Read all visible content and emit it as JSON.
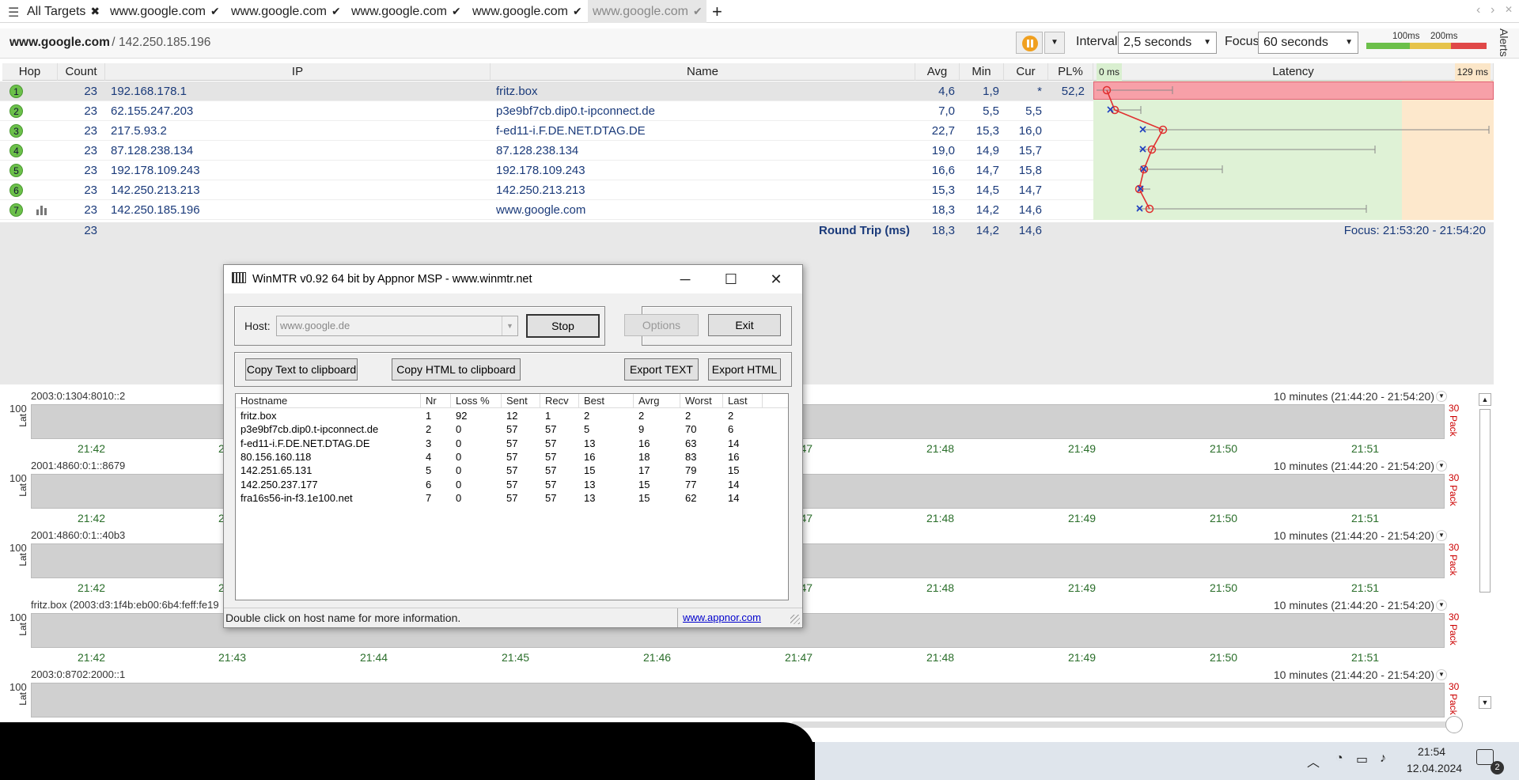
{
  "tabs": [
    {
      "label": "All Targets",
      "mark": "✖"
    },
    {
      "label": "www.google.com",
      "mark": "✔"
    },
    {
      "label": "www.google.com",
      "mark": "✔"
    },
    {
      "label": "www.google.com",
      "mark": "✔"
    },
    {
      "label": "www.google.com",
      "mark": "✔"
    },
    {
      "label": "www.google.com",
      "mark": "✔"
    }
  ],
  "nav": {
    "back": "‹",
    "fwd": "›",
    "close": "✕",
    "add": "+"
  },
  "toolbar": {
    "host": "www.google.com",
    "sep": " / ",
    "ip": "142.250.185.196",
    "interval_label": "Interval",
    "interval_value": "2,5 seconds",
    "focus_label": "Focus",
    "focus_value": "60 seconds",
    "legend_100": "100ms",
    "legend_200": "200ms",
    "alerts": "Alerts",
    "colors": {
      "good": "#6cc04a",
      "warn": "#e6c34a",
      "bad": "#e04848",
      "pause": "#f0a020"
    }
  },
  "grid": {
    "headers": {
      "hop": "Hop",
      "count": "Count",
      "ip": "IP",
      "name": "Name",
      "avg": "Avg",
      "min": "Min",
      "cur": "Cur",
      "pl": "PL%",
      "lat_min": "0 ms",
      "lat": "Latency",
      "lat_max": "129 ms"
    },
    "rows": [
      {
        "hop": "1",
        "count": "23",
        "ip": "192.168.178.1",
        "name": "fritz.box",
        "avg": "4,6",
        "min": "1,9",
        "cur": "*",
        "pl": "52,2"
      },
      {
        "hop": "2",
        "count": "23",
        "ip": "62.155.247.203",
        "name": "p3e9bf7cb.dip0.t-ipconnect.de",
        "avg": "7,0",
        "min": "5,5",
        "cur": "5,5",
        "pl": ""
      },
      {
        "hop": "3",
        "count": "23",
        "ip": "217.5.93.2",
        "name": "f-ed11-i.F.DE.NET.DTAG.DE",
        "avg": "22,7",
        "min": "15,3",
        "cur": "16,0",
        "pl": ""
      },
      {
        "hop": "4",
        "count": "23",
        "ip": "87.128.238.134",
        "name": "87.128.238.134",
        "avg": "19,0",
        "min": "14,9",
        "cur": "15,7",
        "pl": ""
      },
      {
        "hop": "5",
        "count": "23",
        "ip": "192.178.109.243",
        "name": "192.178.109.243",
        "avg": "16,6",
        "min": "14,7",
        "cur": "15,8",
        "pl": ""
      },
      {
        "hop": "6",
        "count": "23",
        "ip": "142.250.213.213",
        "name": "142.250.213.213",
        "avg": "15,3",
        "min": "14,5",
        "cur": "14,7",
        "pl": ""
      },
      {
        "hop": "7",
        "count": "23",
        "ip": "142.250.185.196",
        "name": "www.google.com",
        "avg": "18,3",
        "min": "14,2",
        "cur": "14,6",
        "pl": ""
      }
    ],
    "summary": {
      "count": "23",
      "label": "Round Trip (ms)",
      "avg": "18,3",
      "min": "14,2",
      "cur": "14,6",
      "focus": "Focus: 21:53:20 - 21:54:20"
    }
  },
  "charts": [
    {
      "title": "2003:0:1304:8010::2",
      "range": "10 minutes (21:44:20 - 21:54:20)"
    },
    {
      "title": "2001:4860:0:1::8679",
      "range": "10 minutes (21:44:20 - 21:54:20)"
    },
    {
      "title": "2001:4860:0:1::40b3",
      "range": "10 minutes (21:44:20 - 21:54:20)"
    },
    {
      "title": "fritz.box (2003:d3:1f4b:eb00:6b4:feff:fe19",
      "range": "10 minutes (21:44:20 - 21:54:20)"
    },
    {
      "title": "2003:0:8702:2000::1",
      "range": "10 minutes (21:44:20 - 21:54:20)"
    }
  ],
  "chart_common": {
    "y100": "100",
    "ylabel": "Lat",
    "side_num": "30",
    "side_label": "Pack",
    "times": [
      "21:42",
      "21:43",
      "21:44",
      "21:45",
      "21:46",
      "21:47",
      "21:48",
      "21:49",
      "21:50",
      "21:51"
    ]
  },
  "dialog": {
    "title": "WinMTR v0.92 64 bit by Appnor MSP - www.winmtr.net",
    "host_label": "Host:",
    "host_value": "www.google.de",
    "stop": "Stop",
    "options": "Options",
    "exit": "Exit",
    "copy_text": "Copy Text to clipboard",
    "copy_html": "Copy HTML to clipboard",
    "export_text": "Export TEXT",
    "export_html": "Export HTML",
    "columns": [
      "Hostname",
      "Nr",
      "Loss %",
      "Sent",
      "Recv",
      "Best",
      "Avrg",
      "Worst",
      "Last"
    ],
    "rows": [
      [
        "fritz.box",
        "1",
        "92",
        "12",
        "1",
        "2",
        "2",
        "2",
        "2"
      ],
      [
        "p3e9bf7cb.dip0.t-ipconnect.de",
        "2",
        "0",
        "57",
        "57",
        "5",
        "9",
        "70",
        "6"
      ],
      [
        "f-ed11-i.F.DE.NET.DTAG.DE",
        "3",
        "0",
        "57",
        "57",
        "13",
        "16",
        "63",
        "14"
      ],
      [
        "80.156.160.118",
        "4",
        "0",
        "57",
        "57",
        "16",
        "18",
        "83",
        "16"
      ],
      [
        "142.251.65.131",
        "5",
        "0",
        "57",
        "57",
        "15",
        "17",
        "79",
        "15"
      ],
      [
        "142.250.237.177",
        "6",
        "0",
        "57",
        "57",
        "13",
        "15",
        "77",
        "14"
      ],
      [
        "fra16s56-in-f3.1e100.net",
        "7",
        "0",
        "57",
        "57",
        "13",
        "15",
        "62",
        "14"
      ]
    ],
    "status": "Double click on host name for more information.",
    "link": "www.appnor.com"
  },
  "taskbar": {
    "time": "21:54",
    "date": "12.04.2024",
    "notif": "2"
  }
}
